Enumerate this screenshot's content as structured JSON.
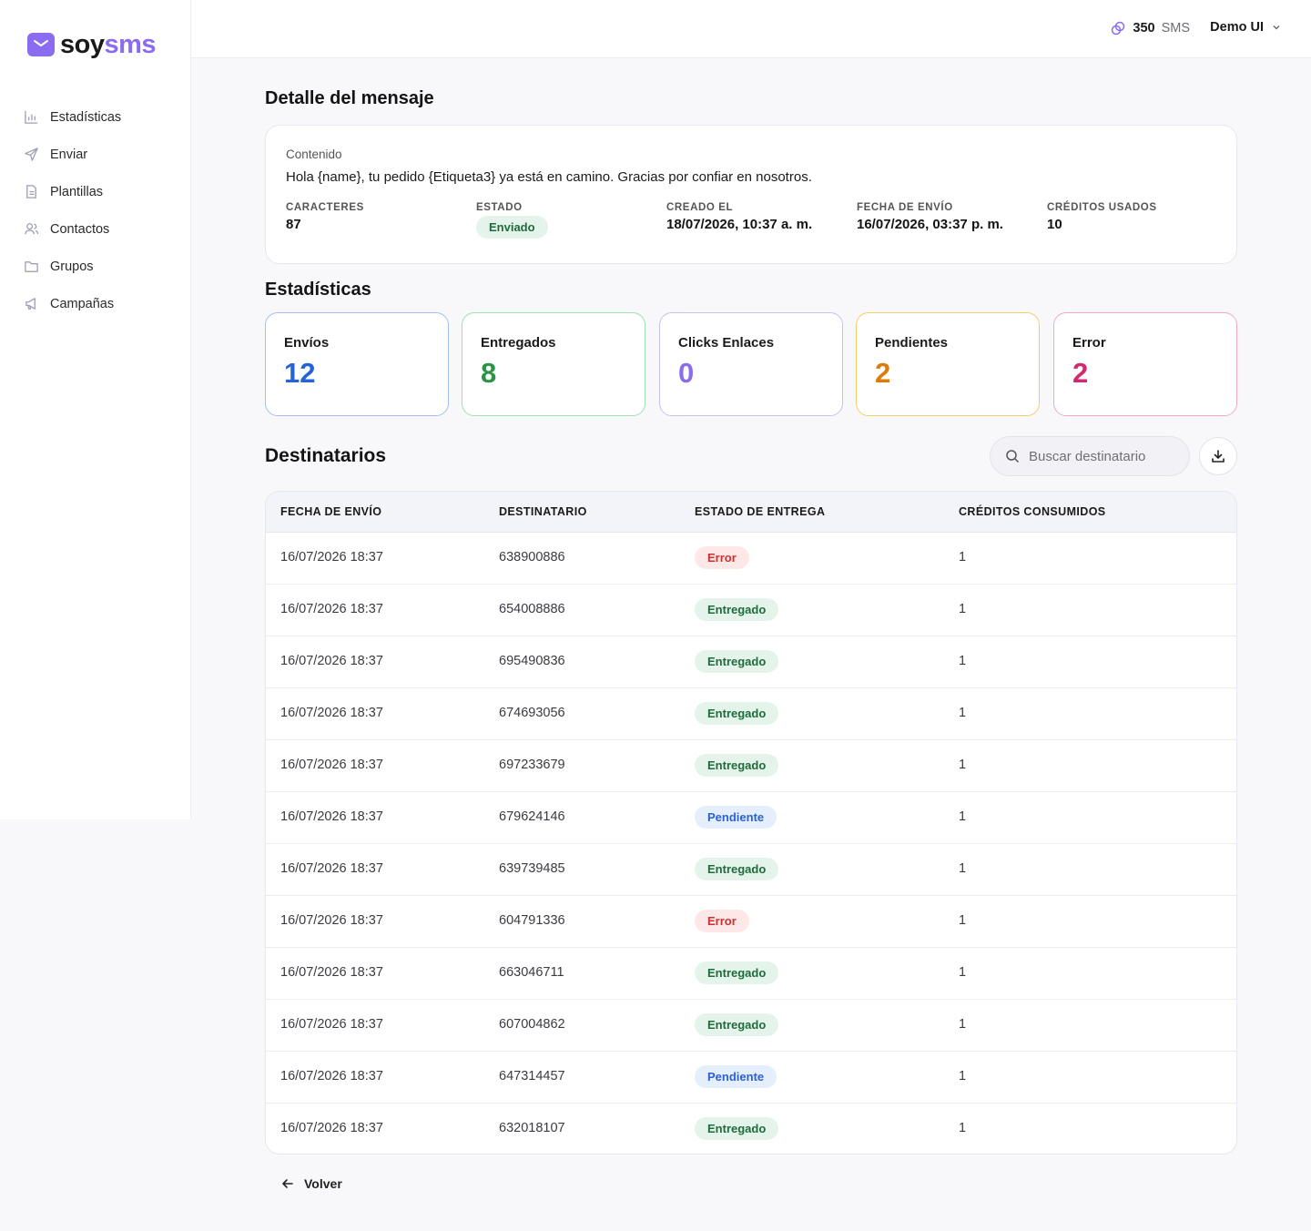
{
  "brand": {
    "part1": "soy",
    "part2": "sms",
    "accent": "#8b6cf0"
  },
  "sidebar": {
    "items": [
      {
        "label": "Estadísticas",
        "icon": "bar-chart-icon"
      },
      {
        "label": "Enviar",
        "icon": "send-icon"
      },
      {
        "label": "Plantillas",
        "icon": "document-icon"
      },
      {
        "label": "Contactos",
        "icon": "users-icon"
      },
      {
        "label": "Grupos",
        "icon": "folder-icon"
      },
      {
        "label": "Campañas",
        "icon": "megaphone-icon"
      }
    ]
  },
  "topbar": {
    "credits": "350",
    "credits_unit": "SMS",
    "user": "Demo UI"
  },
  "detail": {
    "title": "Detalle del mensaje",
    "content_label": "Contenido",
    "message": "Hola {name}, tu pedido {Etiqueta3} ya está en camino. Gracias por confiar en nosotros.",
    "chars_label": "CARACTERES",
    "chars": "87",
    "status_label": "ESTADO",
    "status": "Enviado",
    "created_label": "CREADO EL",
    "created": "18/07/2026, 10:37 a. m.",
    "sent_label": "FECHA DE ENVÍO",
    "sent": "16/07/2026, 03:37 p. m.",
    "credits_label": "CRÉDITOS USADOS",
    "credits": "10"
  },
  "stats": {
    "title": "Estadísticas",
    "cards": [
      {
        "label": "Envíos",
        "value": "12",
        "color": "#2563d6",
        "border": "#9fc0ee"
      },
      {
        "label": "Entregados",
        "value": "8",
        "color": "#2a9444",
        "border": "#9ee0b0"
      },
      {
        "label": "Clicks Enlaces",
        "value": "0",
        "color": "#8b6cf0",
        "border": "#c9bff2"
      },
      {
        "label": "Pendientes",
        "value": "2",
        "color": "#dd7a0c",
        "border": "#f3cf6a"
      },
      {
        "label": "Error",
        "value": "2",
        "color": "#d22a6e",
        "border": "#f1a9c6"
      }
    ]
  },
  "recipients": {
    "title": "Destinatarios",
    "search_placeholder": "Buscar destinatario",
    "columns": [
      "FECHA DE ENVÍO",
      "DESTINATARIO",
      "ESTADO DE ENTREGA",
      "CRÉDITOS CONSUMIDOS"
    ],
    "rows": [
      {
        "date": "16/07/2026 18:37",
        "phone": "638900886",
        "status": "Error",
        "credits": "1"
      },
      {
        "date": "16/07/2026 18:37",
        "phone": "654008886",
        "status": "Entregado",
        "credits": "1"
      },
      {
        "date": "16/07/2026 18:37",
        "phone": "695490836",
        "status": "Entregado",
        "credits": "1"
      },
      {
        "date": "16/07/2026 18:37",
        "phone": "674693056",
        "status": "Entregado",
        "credits": "1"
      },
      {
        "date": "16/07/2026 18:37",
        "phone": "697233679",
        "status": "Entregado",
        "credits": "1"
      },
      {
        "date": "16/07/2026 18:37",
        "phone": "679624146",
        "status": "Pendiente",
        "credits": "1"
      },
      {
        "date": "16/07/2026 18:37",
        "phone": "639739485",
        "status": "Entregado",
        "credits": "1"
      },
      {
        "date": "16/07/2026 18:37",
        "phone": "604791336",
        "status": "Error",
        "credits": "1"
      },
      {
        "date": "16/07/2026 18:37",
        "phone": "663046711",
        "status": "Entregado",
        "credits": "1"
      },
      {
        "date": "16/07/2026 18:37",
        "phone": "607004862",
        "status": "Entregado",
        "credits": "1"
      },
      {
        "date": "16/07/2026 18:37",
        "phone": "647314457",
        "status": "Pendiente",
        "credits": "1"
      },
      {
        "date": "16/07/2026 18:37",
        "phone": "632018107",
        "status": "Entregado",
        "credits": "1"
      }
    ]
  },
  "back_label": "Volver"
}
